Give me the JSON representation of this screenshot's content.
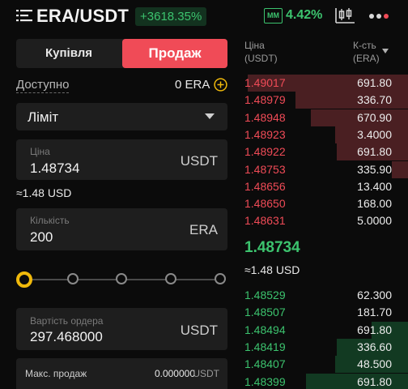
{
  "header": {
    "pair": "ERA/USDT",
    "change": "+3618.35%",
    "mm_label": "MM",
    "mm_value": "4.42%",
    "icons": [
      "menu-icon",
      "candlestick-chart-icon",
      "more-icon"
    ]
  },
  "order_side": {
    "buy_label": "Купівля",
    "sell_label": "Продаж",
    "selected": "Продаж"
  },
  "available": {
    "label": "Доступно",
    "value": "0 ERA"
  },
  "order_type": {
    "label": "Ліміт"
  },
  "price_field": {
    "label": "Ціна",
    "value": "1.48734",
    "unit": "USDT",
    "approx": "≈1.48 USD"
  },
  "amount_field": {
    "label": "Кількість",
    "value": "200",
    "unit": "ERA"
  },
  "slider": {
    "stops": 5,
    "value_percent": 0
  },
  "order_value_field": {
    "label": "Вартість ордера",
    "value": "297.468000",
    "unit": "USDT"
  },
  "max_sell": {
    "label": "Макс. продаж",
    "value": "0.000000",
    "unit": "USDT"
  },
  "orderbook": {
    "price_header": "Ціна",
    "price_header_unit": "(USDT)",
    "qty_header": "К-сть",
    "qty_header_unit": "(ERA)",
    "asks": [
      {
        "price": "1.49017",
        "qty": "691.80",
        "depth": 0.97
      },
      {
        "price": "1.48979",
        "qty": "336.70",
        "depth": 0.68
      },
      {
        "price": "1.48948",
        "qty": "670.90",
        "depth": 0.59
      },
      {
        "price": "1.48923",
        "qty": "3.4000",
        "depth": 0.44
      },
      {
        "price": "1.48922",
        "qty": "691.80",
        "depth": 0.43
      },
      {
        "price": "1.48753",
        "qty": "335.90",
        "depth": 0.1
      },
      {
        "price": "1.48656",
        "qty": "13.400",
        "depth": 0
      },
      {
        "price": "1.48650",
        "qty": "168.00",
        "depth": 0
      },
      {
        "price": "1.48631",
        "qty": "5.0000",
        "depth": 0
      }
    ],
    "mid_price": "1.48734",
    "mid_usd": "≈1.48 USD",
    "bids": [
      {
        "price": "1.48529",
        "qty": "62.300",
        "depth": 0
      },
      {
        "price": "1.48507",
        "qty": "181.70",
        "depth": 0
      },
      {
        "price": "1.48494",
        "qty": "691.80",
        "depth": 0.22
      },
      {
        "price": "1.48419",
        "qty": "336.60",
        "depth": 0.43
      },
      {
        "price": "1.48407",
        "qty": "48.500",
        "depth": 0.44
      },
      {
        "price": "1.48399",
        "qty": "691.80",
        "depth": 0.62
      }
    ]
  },
  "colors": {
    "ask": "#f04b57",
    "bid": "#3cc36e",
    "accent": "#f0b90b"
  }
}
